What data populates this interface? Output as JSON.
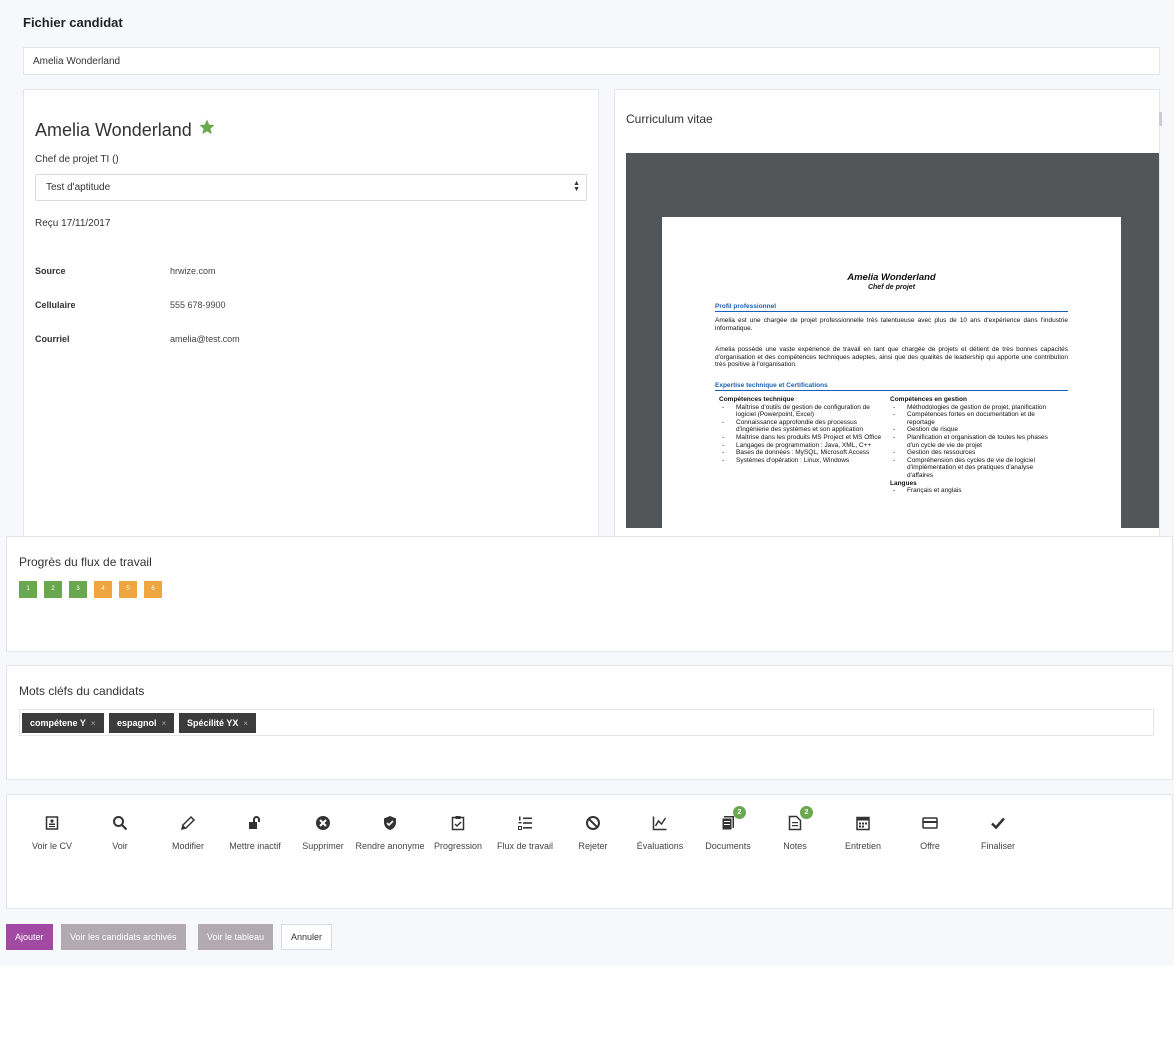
{
  "header": {
    "title": "Fichier candidat"
  },
  "candidate_field": {
    "value": "Amelia Wonderland"
  },
  "candidate": {
    "name": "Amelia Wonderland",
    "job_title": "Chef de projet TI ()",
    "status_select": "Test d'aptitude",
    "received": "Reçu 17/11/2017",
    "details": [
      {
        "label": "Source",
        "value": "hrwize.com"
      },
      {
        "label": "Cellulaire",
        "value": "555 678-9900"
      },
      {
        "label": "Courriel",
        "value": "amelia@test.com"
      }
    ]
  },
  "cv": {
    "title": "Curriculum vitae",
    "doc_name": "Amelia Wonderland",
    "doc_role": "Chef de projet",
    "section_profile": "Profil professionnel",
    "profile_p1": "Amelia est une chargée de projet professionnelle très talentueuse avec plus de 10 ans d'expérience dans l'industrie informatique.",
    "profile_p2": "Amelia possède une vaste expérience de travail en tant que chargée de projets et détient de très bonnes capacités d'organisation et des compétences techniques adeptes, ainsi que des qualités de leadership qui apporte une contribution très positive à l'organisation.",
    "section_expertise": "Expertise technique et Certifications",
    "tech_heading": "Compétences technique",
    "tech_items": [
      "Maîtrise d'outils de gestion de configuration de logiciel (Powerpoint, Excel)",
      "Connaissance approfondie des processus d'ingénierie des systèmes et son application",
      "Maîtrise dans les produits MS Project et MS Office",
      "Langages de programmation : Java, XML, C++",
      "Bases de données : MySQL, Microsoft Access",
      "Systèmes d'opération : Linux, Windows"
    ],
    "mgmt_heading": "Compétences en gestion",
    "mgmt_items": [
      "Méthodologies de gestion de projet, planification",
      "Compétences fortes en documentation et de reportage",
      "Gestion de risque",
      "Planification et organisation de toutes les phases d'un cycle de vie de projet",
      "Gestion des ressources",
      "Compréhension des cycles de vie de logiciel d'implémentation et des pratiques d'analyse d'affaires"
    ],
    "lang_heading": "Langues",
    "lang_items": [
      "Français et anglais"
    ]
  },
  "workflow": {
    "title": "Progrès du flux de travail",
    "steps": [
      {
        "label": "1",
        "color": "#6aa84f"
      },
      {
        "label": "2",
        "color": "#6aa84f"
      },
      {
        "label": "3",
        "color": "#6aa84f"
      },
      {
        "label": "4",
        "color": "#f0a640"
      },
      {
        "label": "5",
        "color": "#f0a640"
      },
      {
        "label": "6",
        "color": "#f0a640"
      }
    ]
  },
  "keywords": {
    "title": "Mots cléfs du candidats",
    "tags": [
      "compétene Y",
      "espagnol",
      "Spécilité YX"
    ],
    "remove_symbol": "×"
  },
  "actions": [
    {
      "label": "Voir le CV",
      "icon": "cv-icon"
    },
    {
      "label": "Voir",
      "icon": "search-icon"
    },
    {
      "label": "Modifier",
      "icon": "pencil-icon"
    },
    {
      "label": "Mettre inactif",
      "icon": "unlock-icon"
    },
    {
      "label": "Supprimer",
      "icon": "circle-x-icon"
    },
    {
      "label": "Rendre anonyme",
      "icon": "shield-icon"
    },
    {
      "label": "Progression",
      "icon": "clipboard-check-icon"
    },
    {
      "label": "Flux de travail",
      "icon": "ordered-list-icon"
    },
    {
      "label": "Rejeter",
      "icon": "ban-icon"
    },
    {
      "label": "Évaluations",
      "icon": "line-chart-icon"
    },
    {
      "label": "Documents",
      "icon": "documents-icon",
      "badge": "2"
    },
    {
      "label": "Notes",
      "icon": "notes-icon",
      "badge": "2"
    },
    {
      "label": "Entretien",
      "icon": "calendar-icon"
    },
    {
      "label": "Offre",
      "icon": "credit-card-icon"
    },
    {
      "label": "Finaliser",
      "icon": "check-icon"
    }
  ],
  "footer": {
    "add": "Ajouter",
    "archived": "Voir les candidats archivés",
    "board": "Voir le tableau",
    "cancel": "Annuler"
  },
  "colors": {
    "accent": "#a04aa3",
    "star": "#6aa84f",
    "step_done": "#6aa84f",
    "step_pending": "#f0a640"
  }
}
